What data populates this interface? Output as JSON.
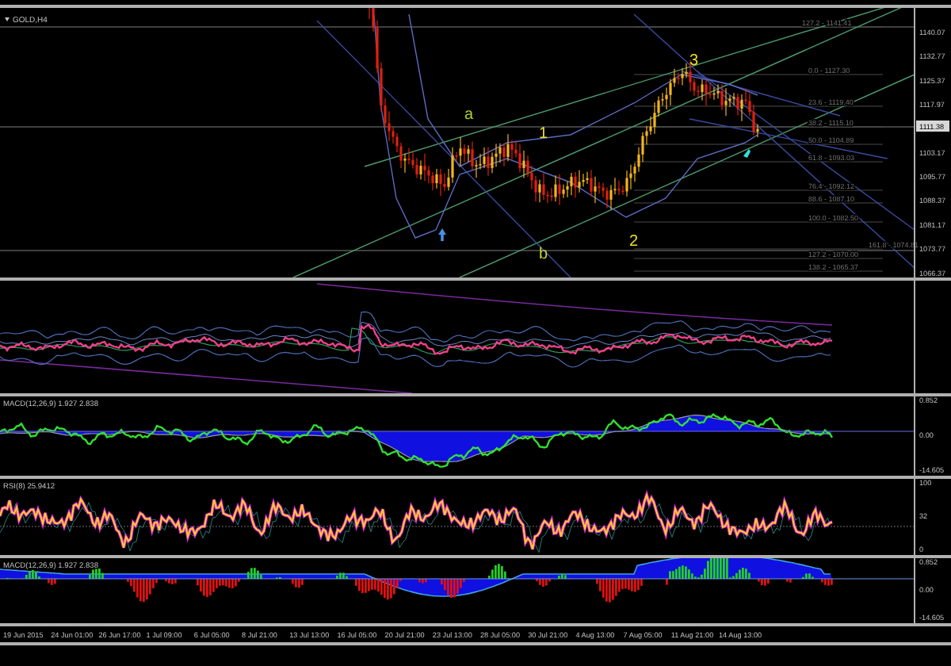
{
  "chart": {
    "symbol": "GOLD,H4",
    "price_axis": [
      "1140.07",
      "1132.77",
      "1125.37",
      "1117.97",
      "1103.17",
      "1095.77",
      "1088.37",
      "1081.17",
      "1073.77",
      "1066.37"
    ],
    "current_price": "1111.38",
    "fib_levels": [
      "127.2 - 1141.41",
      "0.0 - 1127.30",
      "23.6 - 1119.40",
      "38.2 - 1115.10",
      "50.0 - 1104.89",
      "61.8 - 1093.03",
      "76.4 - 1092.12",
      "88.6 - 1087.10",
      "100.0 - 1082.50",
      "161.8 - 1074.81",
      "127.2 - 1070.00",
      "138.2 - 1065.37"
    ],
    "wave_labels": [
      {
        "text": "a",
        "color": "#a8d02a"
      },
      {
        "text": "1",
        "color": "#e8e020"
      },
      {
        "text": "b",
        "color": "#c8d030"
      },
      {
        "text": "2",
        "color": "#e8e020"
      },
      {
        "text": "3",
        "color": "#e8e020"
      }
    ]
  },
  "indicators": [
    {
      "kind": "bands"
    },
    {
      "kind": "macd",
      "label": "MACD(12,26,9) 1.927 2.838",
      "axis": [
        "0.852",
        "0.00",
        "-14.605"
      ]
    },
    {
      "kind": "rsi",
      "label": "RSI(8) 25.9412",
      "axis": [
        "100",
        "32",
        "0"
      ]
    },
    {
      "kind": "osma",
      "label": "MACD(12,26,9) 1.927 2.838",
      "axis": [
        "0.852",
        "0.00",
        "-14.605"
      ]
    }
  ],
  "time_axis": [
    "19 Jun 2015",
    "24 Jun 01:00",
    "26 Jun 17:00",
    "1 Jul 09:00",
    "6 Jul 05:00",
    "8 Jul 21:00",
    "13 Jul 13:00",
    "16 Jul 05:00",
    "20 Jul 21:00",
    "23 Jul 13:00",
    "28 Jul 05:00",
    "30 Jul 21:00",
    "4 Aug 13:00",
    "7 Aug 05:00",
    "11 Aug 21:00",
    "14 Aug 13:00"
  ]
}
